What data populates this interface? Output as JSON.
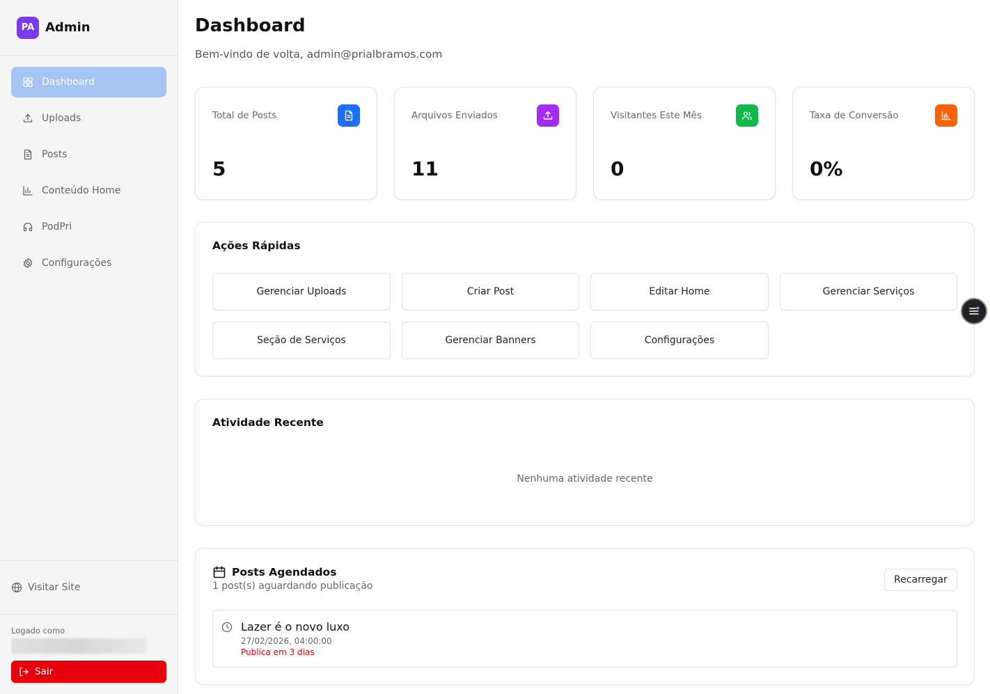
{
  "sidebar": {
    "brand": {
      "logo_text": "PA",
      "name": "Admin"
    },
    "items": [
      {
        "label": "Dashboard",
        "icon": "dashboard-icon",
        "active": true
      },
      {
        "label": "Uploads",
        "icon": "upload-icon",
        "active": false
      },
      {
        "label": "Posts",
        "icon": "file-text-icon",
        "active": false
      },
      {
        "label": "Conteúdo Home",
        "icon": "bar-chart-icon",
        "active": false
      },
      {
        "label": "PodPri",
        "icon": "headphones-icon",
        "active": false
      },
      {
        "label": "Configurações",
        "icon": "gear-icon",
        "active": false
      }
    ],
    "visit_site": "Visitar Site",
    "logged_as": "Logado como",
    "logout": "Sair"
  },
  "header": {
    "title": "Dashboard",
    "welcome": "Bem-vindo de volta, admin@prialbramos.com"
  },
  "stats": [
    {
      "label": "Total de Posts",
      "value": "5",
      "icon": "file-text-icon",
      "color": "#1d6ef5"
    },
    {
      "label": "Arquivos Enviados",
      "value": "11",
      "icon": "upload-icon",
      "color": "#a22cf0"
    },
    {
      "label": "Visitantes Este Mês",
      "value": "0",
      "icon": "users-icon",
      "color": "#12b84a"
    },
    {
      "label": "Taxa de Conversão",
      "value": "0%",
      "icon": "bar-chart-icon",
      "color": "#f5620a"
    }
  ],
  "quick_actions": {
    "title": "Ações Rápidas",
    "buttons": [
      "Gerenciar Uploads",
      "Criar Post",
      "Editar Home",
      "Gerenciar Serviços",
      "Seção de Serviços",
      "Gerenciar Banners",
      "Configurações"
    ]
  },
  "recent_activity": {
    "title": "Atividade Recente",
    "empty": "Nenhuma atividade recente"
  },
  "scheduled": {
    "title": "Posts Agendados",
    "subtitle": "1 post(s) aguardando publicação",
    "reload": "Recarregar",
    "posts": [
      {
        "title": "Lazer é o novo luxo",
        "date": "27/02/2026, 04:00:00",
        "status": "Publica em 3 dias"
      }
    ]
  },
  "colors": {
    "accent_active": "#a5c4f4",
    "danger": "#e7000b",
    "brand": "#7c3aed"
  }
}
